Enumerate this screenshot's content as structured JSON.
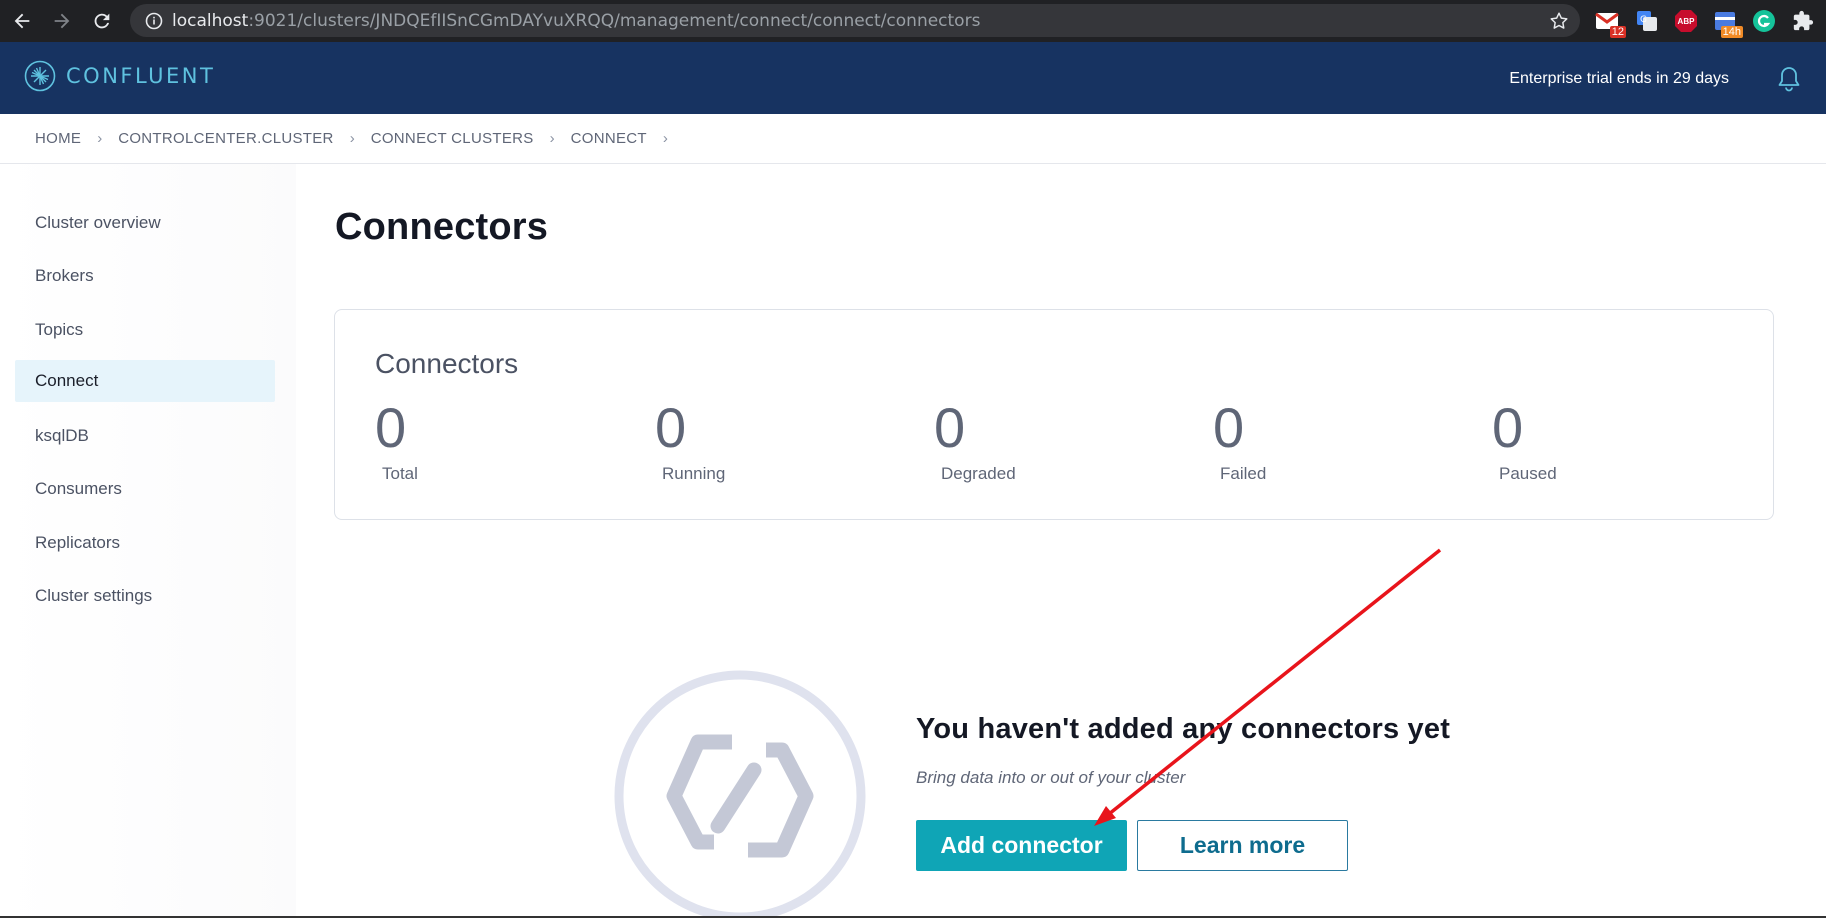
{
  "browser": {
    "url_host": "localhost",
    "url_rest": ":9021/clusters/JNDQEfIISnCGmDAYvuXRQQ/management/connect/connect/connectors",
    "extensions": [
      {
        "name": "gmail-icon",
        "badge": "12",
        "color": "#d93025"
      },
      {
        "name": "translate-icon",
        "badge": "",
        "color": "#4285f4"
      },
      {
        "name": "adblock-icon",
        "badge": "ABP",
        "color": "#c70d2c"
      },
      {
        "name": "calendar-icon",
        "badge": "14h",
        "color": "#4a7be0"
      },
      {
        "name": "grammarly-icon",
        "badge": "",
        "color": "#15c39a"
      },
      {
        "name": "extensions-icon",
        "badge": "",
        "color": "#e8eaed"
      }
    ]
  },
  "header": {
    "logo_text": "CONFLUENT",
    "trial_text": "Enterprise trial ends in 29 days"
  },
  "breadcrumb": [
    "HOME",
    "CONTROLCENTER.CLUSTER",
    "CONNECT CLUSTERS",
    "CONNECT"
  ],
  "sidebar": {
    "items": [
      {
        "label": "Cluster overview",
        "active": false
      },
      {
        "label": "Brokers",
        "active": false
      },
      {
        "label": "Topics",
        "active": false
      },
      {
        "label": "Connect",
        "active": true
      },
      {
        "label": "ksqlDB",
        "active": false
      },
      {
        "label": "Consumers",
        "active": false
      },
      {
        "label": "Replicators",
        "active": false
      },
      {
        "label": "Cluster settings",
        "active": false
      }
    ]
  },
  "main": {
    "title": "Connectors",
    "card": {
      "title": "Connectors",
      "stats": [
        {
          "value": "0",
          "label": "Total"
        },
        {
          "value": "0",
          "label": "Running"
        },
        {
          "value": "0",
          "label": "Degraded"
        },
        {
          "value": "0",
          "label": "Failed"
        },
        {
          "value": "0",
          "label": "Paused"
        }
      ]
    },
    "empty": {
      "title": "You haven't added any connectors yet",
      "subtitle": "Bring data into or out of your cluster",
      "primary_button": "Add connector",
      "secondary_button": "Learn more"
    }
  },
  "colors": {
    "header_bg": "#173361",
    "accent": "#0fa5b6",
    "annotation": "#e8141b"
  }
}
